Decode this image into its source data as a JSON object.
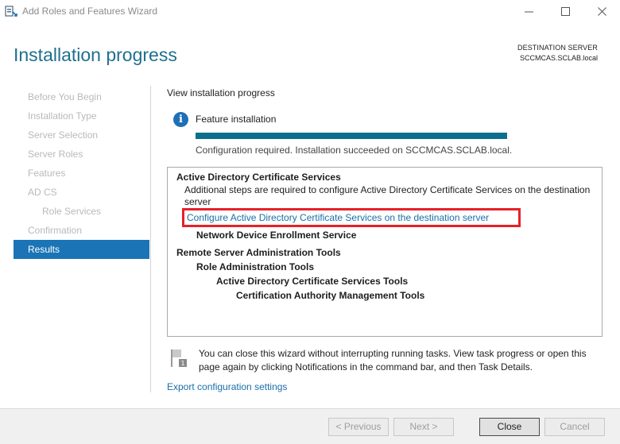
{
  "window": {
    "title": "Add Roles and Features Wizard",
    "controls": {
      "minimize": "—",
      "maximize": "☐",
      "close": "✕"
    }
  },
  "header": {
    "title": "Installation progress",
    "destination_label": "DESTINATION SERVER",
    "destination_server": "SCCMCAS.SCLAB.local"
  },
  "nav": {
    "items": [
      {
        "label": "Before You Begin"
      },
      {
        "label": "Installation Type"
      },
      {
        "label": "Server Selection"
      },
      {
        "label": "Server Roles"
      },
      {
        "label": "Features"
      },
      {
        "label": "AD CS"
      },
      {
        "label": "Role Services"
      },
      {
        "label": "Confirmation"
      },
      {
        "label": "Results"
      }
    ],
    "active": "Results"
  },
  "main": {
    "section_title": "View installation progress",
    "feature_label": "Feature installation",
    "progress_fraction": 1.0,
    "status": "Configuration required. Installation succeeded on SCCMCAS.SCLAB.local.",
    "results": {
      "adcs_heading": "Active Directory Certificate Services",
      "adcs_message": "Additional steps are required to configure Active Directory Certificate Services on the destination server",
      "adcs_link": "Configure Active Directory Certificate Services on the destination server",
      "ndes": "Network Device Enrollment Service",
      "rsat": "Remote Server Administration Tools",
      "rat": "Role Administration Tools",
      "adcs_tools": "Active Directory Certificate Services Tools",
      "ca_tools": "Certification Authority Management Tools"
    },
    "note": "You can close this wizard without interrupting running tasks. View task progress or open this page again by clicking Notifications in the command bar, and then Task Details.",
    "export_link": "Export configuration settings"
  },
  "footer": {
    "previous": "< Previous",
    "next": "Next >",
    "close": "Close",
    "cancel": "Cancel"
  },
  "colors": {
    "accent": "#1a74b6",
    "progress": "#0c6f8e",
    "highlight": "#e8202a",
    "link": "#1a6fa8"
  }
}
